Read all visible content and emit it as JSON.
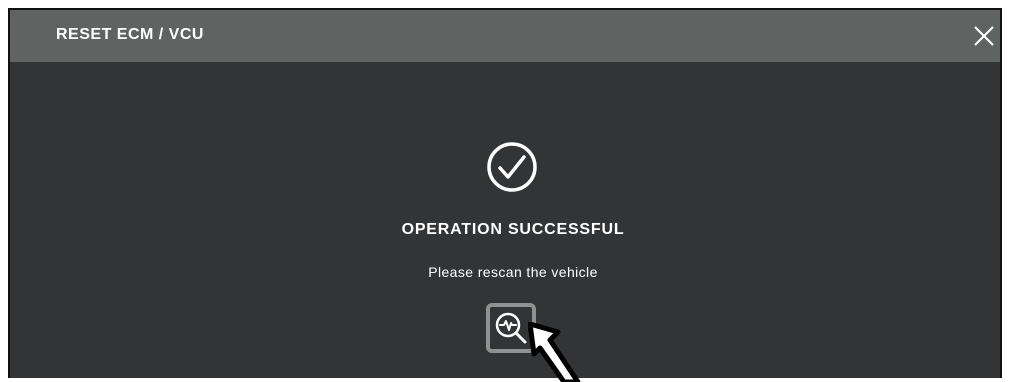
{
  "dialog": {
    "title": "RESET ECM / VCU",
    "close_icon": "close-icon",
    "status_icon": "check-circle-icon",
    "status_text": "OPERATION SUCCESSFUL",
    "hint_text": "Please rescan the vehicle",
    "rescan_icon": "scan-magnifier-icon",
    "pointer_icon": "mouse-pointer-icon"
  },
  "colors": {
    "titlebar": "#5f6462",
    "body": "#323436",
    "text": "#ffffff",
    "button_border": "#8f9290"
  }
}
